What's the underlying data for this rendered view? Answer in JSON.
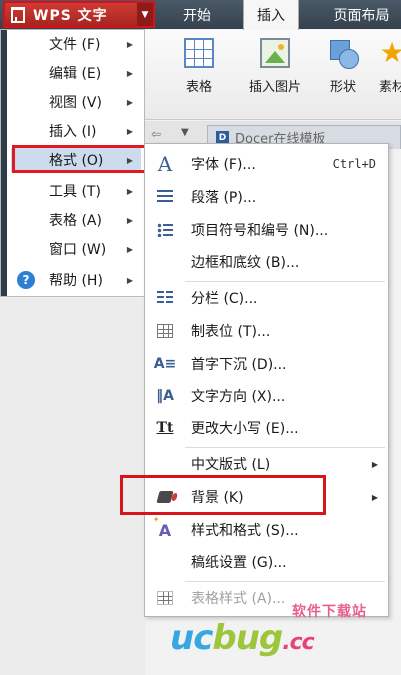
{
  "app_menu": {
    "title": "WPS 文字"
  },
  "ribbon_tabs": [
    "开始",
    "插入",
    "页面布局"
  ],
  "ribbon": {
    "buttons": [
      {
        "label": "表格"
      },
      {
        "label": "插入图片"
      },
      {
        "label": "形状"
      },
      {
        "label": "素材"
      }
    ]
  },
  "doc_tab": {
    "label": "Docer在线模板"
  },
  "main_menu": {
    "items": [
      {
        "label": "文件 (F)"
      },
      {
        "label": "编辑 (E)"
      },
      {
        "label": "视图 (V)"
      },
      {
        "label": "插入 (I)"
      },
      {
        "label": "格式 (O)"
      },
      {
        "label": "工具 (T)"
      },
      {
        "label": "表格 (A)"
      },
      {
        "label": "窗口 (W)"
      },
      {
        "label": "帮助 (H)"
      }
    ]
  },
  "format_menu": {
    "items": [
      {
        "label": "字体 (F)...",
        "shortcut": "Ctrl+D"
      },
      {
        "label": "段落 (P)..."
      },
      {
        "label": "项目符号和编号 (N)..."
      },
      {
        "label": "边框和底纹 (B)..."
      },
      {
        "label": "分栏 (C)..."
      },
      {
        "label": "制表位 (T)..."
      },
      {
        "label": "首字下沉 (D)..."
      },
      {
        "label": "文字方向 (X)..."
      },
      {
        "label": "更改大小写 (E)..."
      },
      {
        "label": "中文版式 (L)"
      },
      {
        "label": "背景 (K)"
      },
      {
        "label": "样式和格式 (S)..."
      },
      {
        "label": "稿纸设置 (G)..."
      },
      {
        "label": "表格样式 (A)..."
      }
    ]
  },
  "watermark": {
    "small": "软件下载站",
    "big_a": "uc",
    "big_b": "bug",
    "big_c": ".cc"
  },
  "colors": {
    "highlight_box": "#d6141c",
    "menu_hover": "#ccdcee",
    "accent": "#3a5f93"
  }
}
